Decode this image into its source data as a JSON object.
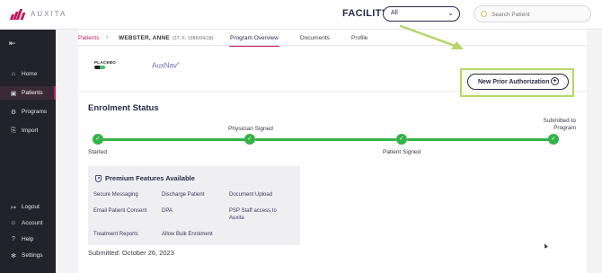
{
  "brand": {
    "name": "AUXITA",
    "accent": "#c2185b"
  },
  "header": {
    "facility_label": "FACILITY",
    "facility_value": "All",
    "search_placeholder": "Search Patient"
  },
  "sidebar": {
    "items": [
      {
        "label": "Home",
        "icon": "home-icon"
      },
      {
        "label": "Patients",
        "icon": "patients-icon",
        "active": true
      },
      {
        "label": "Programs",
        "icon": "programs-icon"
      },
      {
        "label": "Import",
        "icon": "import-icon"
      },
      {
        "label": "Logout",
        "icon": "logout-icon"
      },
      {
        "label": "Account",
        "icon": "account-icon"
      },
      {
        "label": "Help",
        "icon": "help-icon"
      },
      {
        "label": "Settings",
        "icon": "settings-icon"
      }
    ]
  },
  "breadcrumb": {
    "root": "Patients",
    "patient_name": "WEBSTER, ANNE",
    "patient_meta": "(37, F, 1986/04/18)"
  },
  "tabs": [
    "Program Overview",
    "Documents",
    "Profile"
  ],
  "program": {
    "sponsor_logo_text": "PLACEBO",
    "product_name": "AuxNav",
    "product_mark": "®",
    "new_prior_auth_label": "New Prior Authorization"
  },
  "enrolment": {
    "title": "Enrolment Status",
    "steps": [
      {
        "label": "Started",
        "status": "complete"
      },
      {
        "label": "Physician Signed",
        "status": "complete"
      },
      {
        "label": "Patient Signed",
        "status": "complete"
      },
      {
        "label": "Submitted to Program",
        "status": "complete"
      }
    ],
    "step_color": "#35b24a"
  },
  "premium": {
    "title": "Premium Features Available",
    "features": [
      "Secure Messaging",
      "Discharge Patient",
      "Document Upload",
      "Email Patient Consent",
      "DPA",
      "PSP Staff access to Auxita",
      "Treatment Reports",
      "Allow Bulk Enrolment"
    ]
  },
  "submitted": "Submitted: October 26, 2023",
  "annotation_color": "#b6d66a"
}
